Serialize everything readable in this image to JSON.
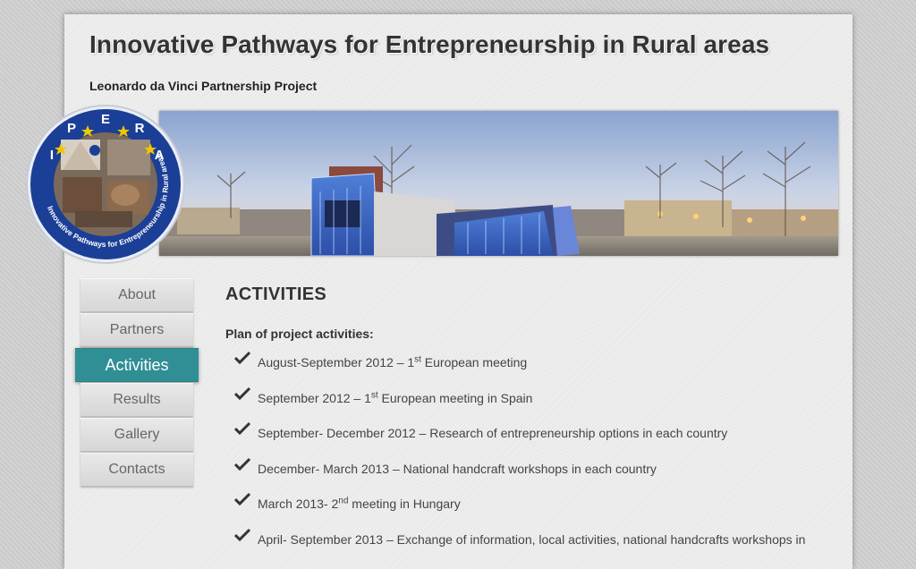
{
  "header": {
    "title": "Innovative Pathways for Entrepreneurship in Rural areas",
    "subtitle": "Leonardo da Vinci Partnership Project"
  },
  "logo": {
    "letters": [
      "I",
      "P",
      "E",
      "R",
      "A"
    ],
    "ring_text": "Innovative Pathways for Entrepreneurship in Rural areas"
  },
  "nav": {
    "items": [
      {
        "label": "About"
      },
      {
        "label": "Partners"
      },
      {
        "label": "Activities",
        "active": true
      },
      {
        "label": "Results"
      },
      {
        "label": "Gallery"
      },
      {
        "label": "Contacts"
      }
    ]
  },
  "content": {
    "heading": "ACTIVITIES",
    "plan_heading": "Plan of project activities:",
    "activities": [
      {
        "pre": "August-September 2012 – 1",
        "sup": "st",
        "post": " European meeting"
      },
      {
        "pre": "September 2012 – 1",
        "sup": "st",
        "post": " European meeting in Spain"
      },
      {
        "pre": "September- December 2012 – Research of entrepreneurship options in each country",
        "sup": "",
        "post": ""
      },
      {
        "pre": "December- March 2013 – National handcraft workshops in each country",
        "sup": "",
        "post": ""
      },
      {
        "pre": "March 2013- 2",
        "sup": "nd",
        "post": " meeting in Hungary"
      },
      {
        "pre": "April- September 2013 – Exchange of information, local activities, national handcrafts workshops in",
        "sup": "",
        "post": ""
      }
    ]
  },
  "colors": {
    "accent": "#2f8f95",
    "logo_blue": "#1b3f96",
    "logo_star": "#f2c500"
  }
}
